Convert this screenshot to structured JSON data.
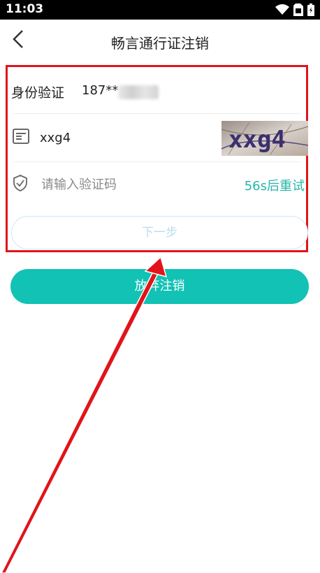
{
  "status_bar": {
    "time": "11:03"
  },
  "nav": {
    "title": "畅言通行证注销"
  },
  "form": {
    "identity_label": "身份验证",
    "phone_masked": "187**",
    "captcha_value": "xxg4",
    "captcha_image_text": "xxg4",
    "sms_placeholder": "请输入验证码",
    "resend_label": "56s后重试",
    "next_label": "下一步"
  },
  "abandon_label": "放弃注销",
  "colors": {
    "accent": "#12c2b4",
    "resend_text": "#27b5a8",
    "highlight_border": "#e0141a"
  },
  "icons": {
    "back": "chevron-left-icon",
    "captcha": "form-icon",
    "sms": "shield-check-icon",
    "wifi": "wifi-icon",
    "sim": "sim-card-icon",
    "battery": "battery-icon"
  }
}
